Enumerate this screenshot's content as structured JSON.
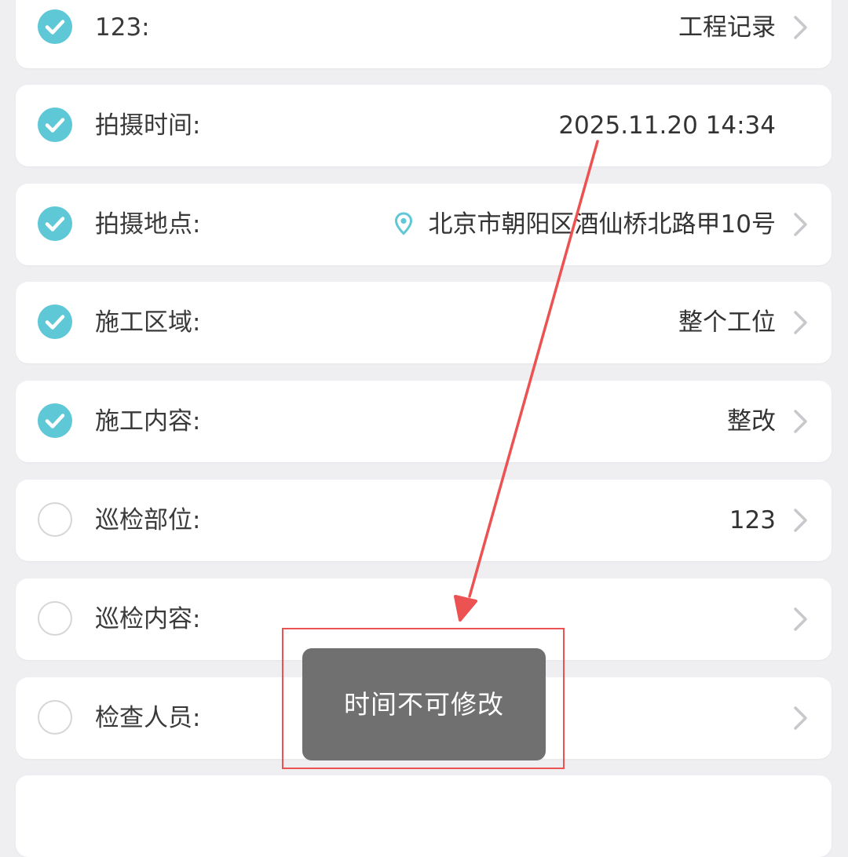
{
  "colors": {
    "accent": "#5ec8d6",
    "page_bg": "#efeff2",
    "annotation": "#ec5252",
    "toast_bg": "#707070"
  },
  "rows": [
    {
      "label": "123:",
      "value": "工程记录",
      "checked": true,
      "chevron": true
    },
    {
      "label": "拍摄时间:",
      "value": "2025.11.20 14:34",
      "checked": true,
      "chevron": false
    },
    {
      "label": "拍摄地点:",
      "value": "北京市朝阳区酒仙桥北路甲10号",
      "checked": true,
      "chevron": true,
      "icon": "location-pin-icon"
    },
    {
      "label": "施工区域:",
      "value": "整个工位",
      "checked": true,
      "chevron": true
    },
    {
      "label": "施工内容:",
      "value": "整改",
      "checked": true,
      "chevron": true
    },
    {
      "label": "巡检部位:",
      "value": "123",
      "checked": false,
      "chevron": true
    },
    {
      "label": "巡检内容:",
      "value": "",
      "checked": false,
      "chevron": true
    },
    {
      "label": "检查人员:",
      "value": "",
      "checked": false,
      "chevron": true
    }
  ],
  "toast": {
    "message": "时间不可修改"
  }
}
